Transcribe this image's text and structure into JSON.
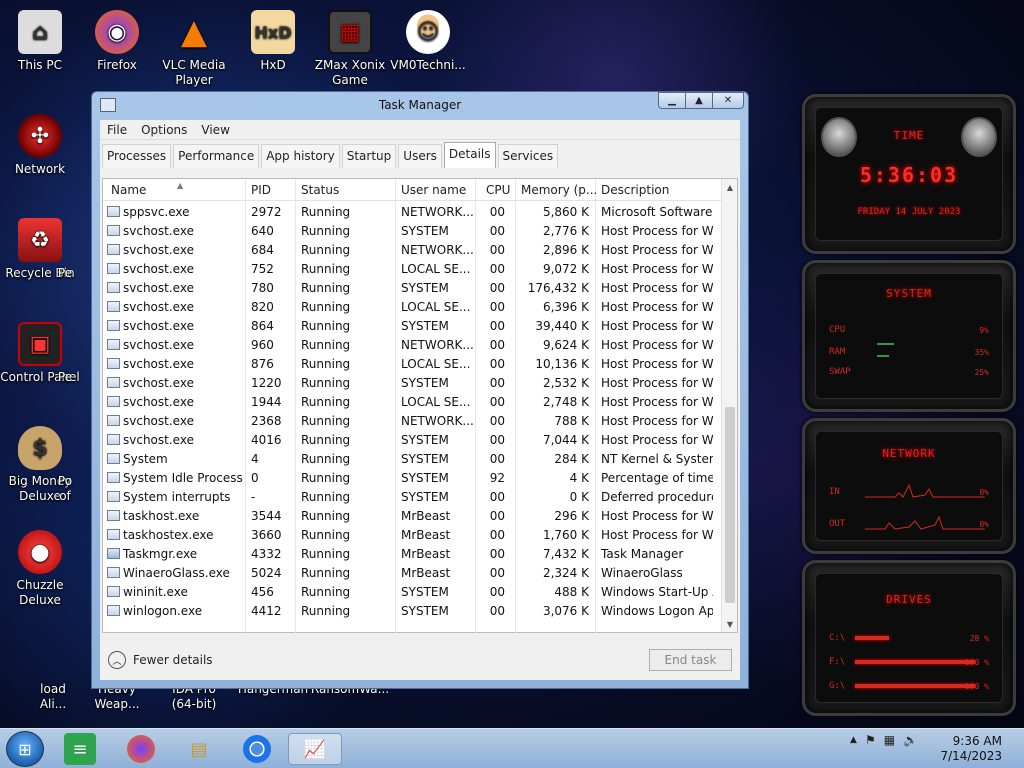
{
  "desktop": {
    "icons": [
      {
        "label": "This PC",
        "icon": "computer-icon"
      },
      {
        "label": "Firefox",
        "icon": "firefox-icon"
      },
      {
        "label": "VLC Media Player",
        "icon": "vlc-icon"
      },
      {
        "label": "HxD",
        "icon": "hxd-icon"
      },
      {
        "label": "ZMax Xonix Game",
        "icon": "game-icon"
      },
      {
        "label": "VM0Techni...",
        "icon": "technician-icon"
      },
      {
        "label": "Network",
        "icon": "network-icon"
      },
      {
        "label": "Recycle Bin",
        "icon": "recycle-bin-icon"
      },
      {
        "label": "Control Panel",
        "icon": "control-panel-icon"
      },
      {
        "label": "Big Money Deluxe",
        "icon": "money-bag-icon"
      },
      {
        "label": "Chuzzle Deluxe",
        "icon": "chuzzle-icon"
      },
      {
        "label": "load Ali...",
        "icon": "download-icon"
      },
      {
        "label": "Heavy Weap...",
        "icon": "game-icon"
      },
      {
        "label": "IDA Pro (64-bit)",
        "icon": "ida-icon"
      },
      {
        "label": "Hangerman",
        "icon": "game-icon"
      },
      {
        "label": "RansomWa...",
        "icon": "program-icon"
      }
    ],
    "partial_labels": [
      "Pe",
      "Pe",
      "Po",
      "of"
    ]
  },
  "window": {
    "title": "Task Manager",
    "controls": {
      "minimize": "▁",
      "maximize": "▲",
      "close": "✕"
    },
    "menu": [
      "File",
      "Options",
      "View"
    ],
    "tabs": [
      "Processes",
      "Performance",
      "App history",
      "Startup",
      "Users",
      "Details",
      "Services"
    ],
    "active_tab": "Details"
  },
  "table": {
    "columns": [
      "Name",
      "PID",
      "Status",
      "User name",
      "CPU",
      "Memory (p...",
      "Description"
    ],
    "sort_indicator": "▲",
    "rows": [
      [
        "sppsvc.exe",
        "2972",
        "Running",
        "NETWORK...",
        "00",
        "5,860 K",
        "Microsoft Software ..."
      ],
      [
        "svchost.exe",
        "640",
        "Running",
        "SYSTEM",
        "00",
        "2,776 K",
        "Host Process for Wi..."
      ],
      [
        "svchost.exe",
        "684",
        "Running",
        "NETWORK...",
        "00",
        "2,896 K",
        "Host Process for Wi..."
      ],
      [
        "svchost.exe",
        "752",
        "Running",
        "LOCAL SE...",
        "00",
        "9,072 K",
        "Host Process for Wi..."
      ],
      [
        "svchost.exe",
        "780",
        "Running",
        "SYSTEM",
        "00",
        "176,432 K",
        "Host Process for Wi..."
      ],
      [
        "svchost.exe",
        "820",
        "Running",
        "LOCAL SE...",
        "00",
        "6,396 K",
        "Host Process for Wi..."
      ],
      [
        "svchost.exe",
        "864",
        "Running",
        "SYSTEM",
        "00",
        "39,440 K",
        "Host Process for Wi..."
      ],
      [
        "svchost.exe",
        "960",
        "Running",
        "NETWORK...",
        "00",
        "9,624 K",
        "Host Process for Wi..."
      ],
      [
        "svchost.exe",
        "876",
        "Running",
        "LOCAL SE...",
        "00",
        "10,136 K",
        "Host Process for Wi..."
      ],
      [
        "svchost.exe",
        "1220",
        "Running",
        "SYSTEM",
        "00",
        "2,532 K",
        "Host Process for Wi..."
      ],
      [
        "svchost.exe",
        "1944",
        "Running",
        "LOCAL SE...",
        "00",
        "2,748 K",
        "Host Process for Wi..."
      ],
      [
        "svchost.exe",
        "2368",
        "Running",
        "NETWORK...",
        "00",
        "788 K",
        "Host Process for Wi..."
      ],
      [
        "svchost.exe",
        "4016",
        "Running",
        "SYSTEM",
        "00",
        "7,044 K",
        "Host Process for Wi..."
      ],
      [
        "System",
        "4",
        "Running",
        "SYSTEM",
        "00",
        "284 K",
        "NT Kernel & System"
      ],
      [
        "System Idle Process",
        "0",
        "Running",
        "SYSTEM",
        "92",
        "4 K",
        "Percentage of time t..."
      ],
      [
        "System interrupts",
        "-",
        "Running",
        "SYSTEM",
        "00",
        "0 K",
        "Deferred procedure ..."
      ],
      [
        "taskhost.exe",
        "3544",
        "Running",
        "MrBeast",
        "00",
        "296 K",
        "Host Process for Wi..."
      ],
      [
        "taskhostex.exe",
        "3660",
        "Running",
        "MrBeast",
        "00",
        "1,760 K",
        "Host Process for Wi..."
      ],
      [
        "Taskmgr.exe",
        "4332",
        "Running",
        "MrBeast",
        "00",
        "7,432 K",
        "Task Manager"
      ],
      [
        "WinaeroGlass.exe",
        "5024",
        "Running",
        "MrBeast",
        "00",
        "2,324 K",
        "WinaeroGlass"
      ],
      [
        "wininit.exe",
        "456",
        "Running",
        "SYSTEM",
        "00",
        "488 K",
        "Windows Start-Up A..."
      ],
      [
        "winlogon.exe",
        "4412",
        "Running",
        "SYSTEM",
        "00",
        "3,076 K",
        "Windows Logon Ap..."
      ]
    ]
  },
  "footer": {
    "fewer_details": "Fewer details",
    "end_task": "End task"
  },
  "gadget": {
    "time_title": "TIME",
    "time": "5:36:03",
    "date": "FRIDAY 14 JULY 2023",
    "system_title": "SYSTEM",
    "cpu_label": "CPU",
    "cpu_value": "9%",
    "cpu_level": 0.09,
    "ram_label": "RAM",
    "ram_value": "35%",
    "ram_level": 0.35,
    "swap_label": "SWAP",
    "swap_value": "25%",
    "swap_level": 0.25,
    "network_title": "NETWORK",
    "in_label": "IN",
    "in_value": "0%",
    "out_label": "OUT",
    "out_value": "0%",
    "drives_title": "DRIVES",
    "drives": [
      {
        "label": "C:\\",
        "value": "28 %",
        "level": 0.28
      },
      {
        "label": "F:\\",
        "value": "100 %",
        "level": 1.0
      },
      {
        "label": "G:\\",
        "value": "100 %",
        "level": 1.0
      }
    ],
    "accent": "#e2241f"
  },
  "taskbar": {
    "time": "9:36 AM",
    "date": "7/14/2023",
    "tray_up_arrow": "▲"
  }
}
